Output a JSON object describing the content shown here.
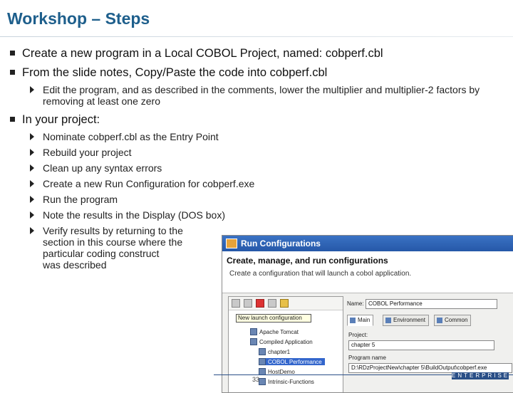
{
  "slide": {
    "title": "Workshop – Steps",
    "page_number": "33"
  },
  "bullets": [
    {
      "text": "Create a new program in a Local COBOL Project, named: cobperf.cbl"
    },
    {
      "text": "From the slide notes, Copy/Paste the code into cobperf.cbl"
    }
  ],
  "sub_bullet_edit": "Edit the program, and as described in the comments, lower the multiplier and multiplier-2 factors by removing at least one zero",
  "bullet_project": "In your project:",
  "project_steps": [
    "Nominate cobperf.cbl as the Entry Point",
    "Rebuild your project",
    "Clean up any syntax errors",
    "Create a new Run Configuration for cobperf.exe",
    "Run the program",
    "Note the results in the Display (DOS box)"
  ],
  "verify_lines": [
    "Verify results by returning to the",
    "section in this course where the",
    "particular coding construct",
    "was described"
  ],
  "dialog": {
    "window_title": "Run Configurations",
    "heading": "Create, manage, and run configurations",
    "subheading": "Create a configuration that will launch a cobol application.",
    "tooltip": "New launch configuration",
    "tree_items": [
      "Apache Tomcat",
      "Compiled Application",
      "chapter1",
      "COBOL Performance",
      "HostDemo",
      "Intrinsic-Functions"
    ],
    "selected_item": "COBOL Performance",
    "name_label": "Name:",
    "name_value": "COBOL Performance",
    "tabs": [
      "Main",
      "Environment",
      "Common"
    ],
    "project_label": "Project:",
    "project_value": "chapter 5",
    "program_label": "Program name",
    "program_value": "D:\\RDzProjectNew\\chapter 5\\BuildOutput\\cobperf.exe"
  },
  "footer_logo_text": "ENTERPRISE"
}
